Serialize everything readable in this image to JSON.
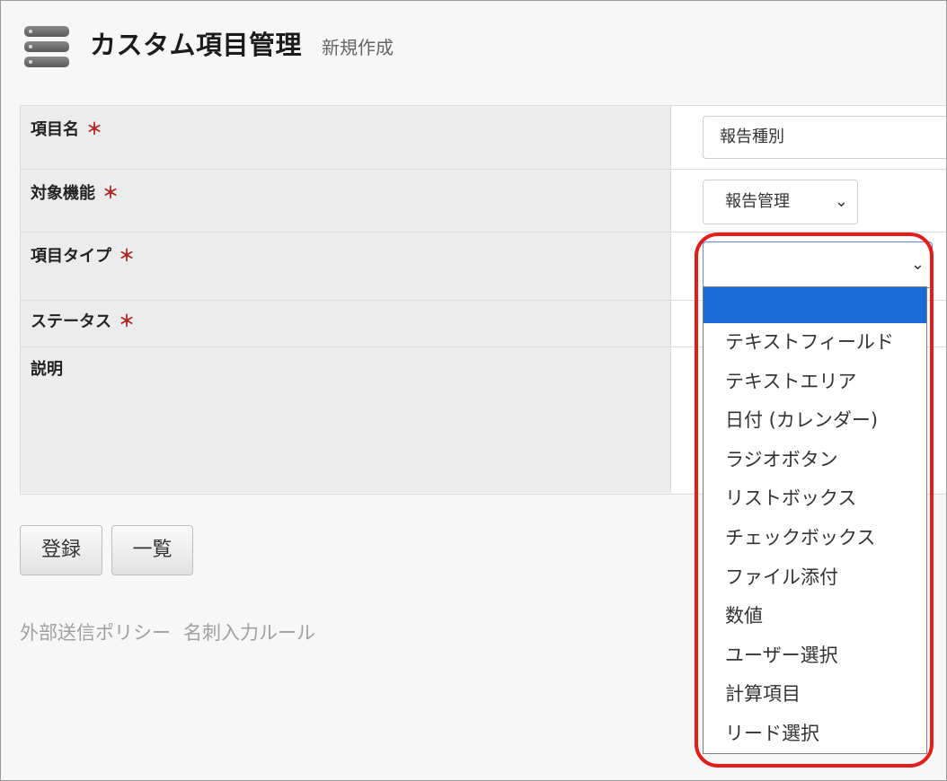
{
  "header": {
    "title": "カスタム項目管理",
    "subtitle": "新規作成",
    "icon": "server-stack-icon"
  },
  "form": {
    "required_mark": "＊",
    "fields": [
      {
        "label": "項目名",
        "value": "報告種別"
      },
      {
        "label": "対象機能",
        "value": "報告管理"
      },
      {
        "label": "項目タイプ",
        "value": ""
      },
      {
        "label": "ステータス"
      },
      {
        "label": "説明"
      }
    ]
  },
  "dropdown": {
    "options": [
      "",
      "テキストフィールド",
      "テキストエリア",
      "日付 (カレンダー)",
      "ラジオボタン",
      "リストボックス",
      "チェックボックス",
      "ファイル添付",
      "数値",
      "ユーザー選択",
      "計算項目",
      "リード選択"
    ],
    "selected_index": 0
  },
  "buttons": {
    "register": "登録",
    "list": "一覧"
  },
  "footer_links": [
    "外部送信ポリシー",
    "名刺入力ルール"
  ],
  "colors": {
    "selected_option": "#1a6bd6",
    "highlight": "#e51c1c",
    "required": "#b02a2a"
  }
}
